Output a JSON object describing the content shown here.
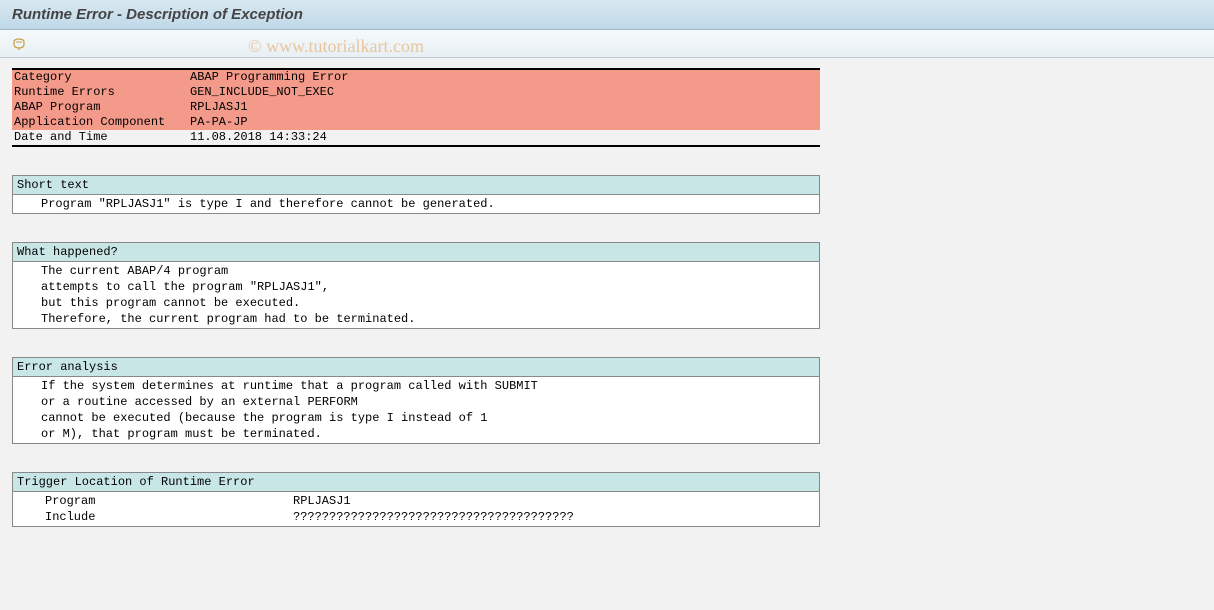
{
  "title": "Runtime Error - Description of Exception",
  "watermark": "© www.tutorialkart.com",
  "errorHeader": {
    "category": {
      "label": "Category",
      "value": "ABAP Programming Error"
    },
    "runtimeErrors": {
      "label": "Runtime Errors",
      "value": "GEN_INCLUDE_NOT_EXEC"
    },
    "abapProgram": {
      "label": "ABAP Program",
      "value": "RPLJASJ1"
    },
    "appComponent": {
      "label": "Application Component",
      "value": "PA-PA-JP"
    },
    "dateTime": {
      "label": "Date and Time",
      "value": "11.08.2018 14:33:24"
    }
  },
  "sections": {
    "shortText": {
      "title": "Short text",
      "lines": [
        "Program \"RPLJASJ1\" is type I and therefore cannot be generated."
      ]
    },
    "whatHappened": {
      "title": "What happened?",
      "lines": [
        "The current ABAP/4 program",
        "attempts to call the program \"RPLJASJ1\",",
        "but this program cannot be executed.",
        "Therefore, the current program had to be terminated."
      ]
    },
    "errorAnalysis": {
      "title": "Error analysis",
      "lines": [
        "If the system determines at runtime that a program called with SUBMIT",
        "or a routine accessed by an external PERFORM",
        "cannot be executed (because the program is type I instead of 1",
        "or M), that program must be terminated."
      ]
    },
    "triggerLocation": {
      "title": "Trigger Location of Runtime Error",
      "program": {
        "label": "Program",
        "value": "RPLJASJ1"
      },
      "include": {
        "label": "Include",
        "value": "???????????????????????????????????????"
      }
    }
  }
}
